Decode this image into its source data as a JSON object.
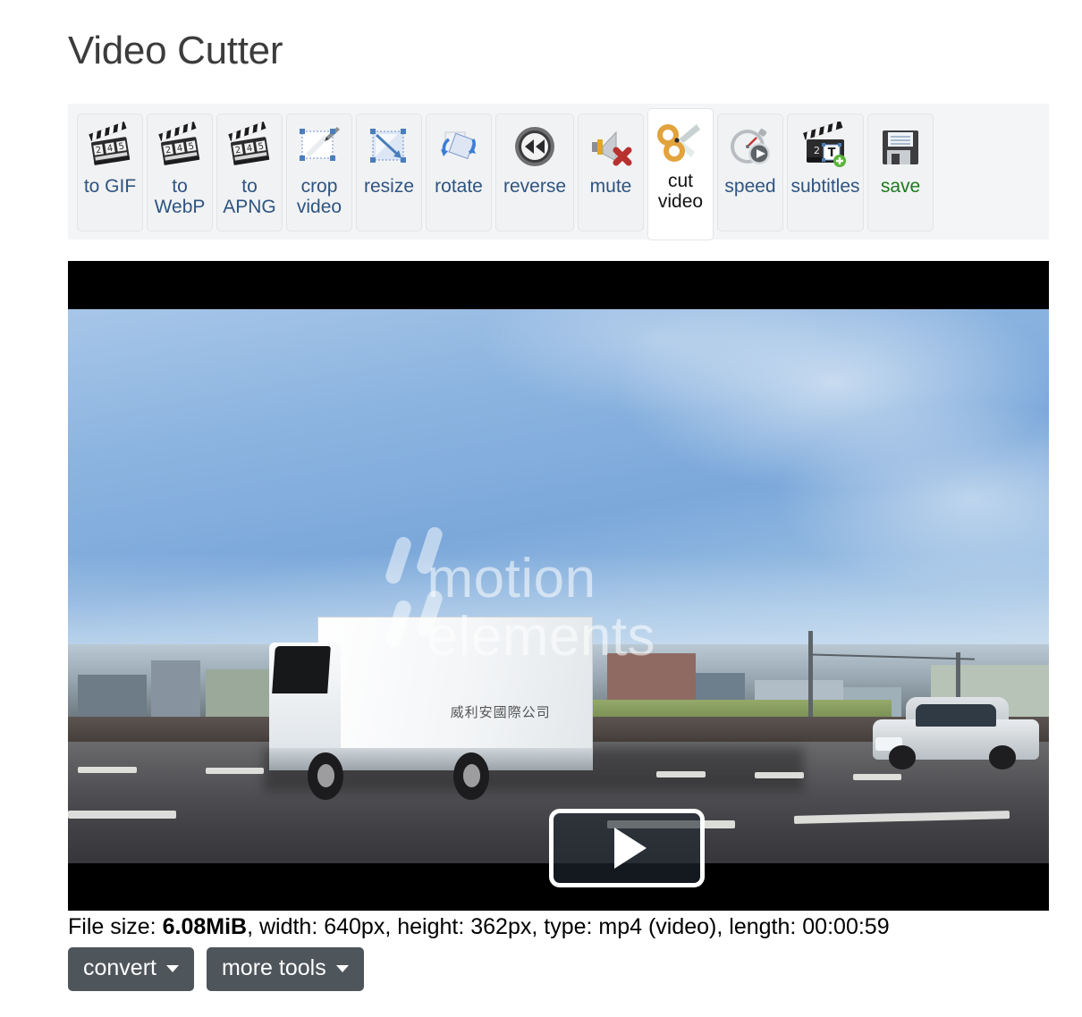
{
  "page": {
    "title": "Video Cutter"
  },
  "toolbar": {
    "items": [
      {
        "label": "to GIF",
        "icon": "clapperboard-icon",
        "active": false,
        "accent": "#2e5481"
      },
      {
        "label": "to WebP",
        "icon": "clapperboard-icon",
        "active": false,
        "accent": "#2e5481"
      },
      {
        "label": "to APNG",
        "icon": "clapperboard-icon",
        "active": false,
        "accent": "#2e5481"
      },
      {
        "label": "crop video",
        "icon": "crop-pen-icon",
        "active": false,
        "accent": "#2e5481"
      },
      {
        "label": "resize",
        "icon": "resize-arrow-icon",
        "active": false,
        "accent": "#2e5481"
      },
      {
        "label": "rotate",
        "icon": "rotate-icon",
        "active": false,
        "accent": "#2e5481"
      },
      {
        "label": "reverse",
        "icon": "rewind-icon",
        "active": false,
        "accent": "#2e5481"
      },
      {
        "label": "mute",
        "icon": "speaker-mute-icon",
        "active": false,
        "accent": "#2e5481"
      },
      {
        "label": "cut video",
        "icon": "scissors-icon",
        "active": true,
        "accent": "#121212"
      },
      {
        "label": "speed",
        "icon": "stopwatch-play-icon",
        "active": false,
        "accent": "#2e5481"
      },
      {
        "label": "subtitles",
        "icon": "clapperboard-text-icon",
        "active": false,
        "accent": "#2e5481"
      },
      {
        "label": "save",
        "icon": "floppy-disk-icon",
        "active": false,
        "accent": "#1d7a1d"
      }
    ]
  },
  "player": {
    "play_button": "play-icon",
    "watermark": "motion elements",
    "truck_text": "威利安國際公司"
  },
  "fileinfo": {
    "label_size": "File size:",
    "size": "6.08MiB",
    "rest": ", width: 640px, height: 362px, type: mp4 (video), length: 00:00:59"
  },
  "actions": {
    "convert": "convert",
    "more_tools": "more tools"
  },
  "colors": {
    "toolbar_bg": "#f4f5f6",
    "tile_bg": "#f1f2f3",
    "link_blue": "#2e5481",
    "save_green": "#1d7a1d",
    "button_gray": "#4e555b",
    "title_gray": "#3c3c3c"
  }
}
